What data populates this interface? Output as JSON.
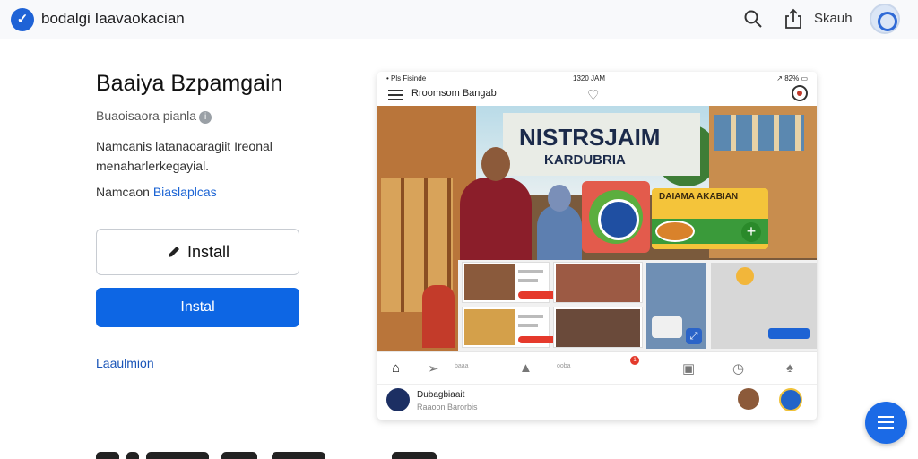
{
  "topbar": {
    "brand_icon": "checkmark-logo",
    "title": "bodalgi Iaavaokacian",
    "search_icon": "search-icon",
    "share_icon": "share-icon",
    "action_label": "Skauh",
    "avatar_icon": "profile-avatar"
  },
  "app": {
    "title": "Baaiya Bzpamgain",
    "subtitle": "Buaoisaora pianla",
    "info_icon": "info-icon",
    "description": "Namcanis latanaoaragiit Ireonal menaharlerkegayial.",
    "link_prefix": "Namcaon",
    "link_text": "Biaslaplcas",
    "install_outline_label": "Install",
    "install_outline_icon": "pencil-icon",
    "install_primary_label": "Instal",
    "bottom_link": "Laaulmion"
  },
  "preview": {
    "status_left": "• Pls Fisinde",
    "status_mid": "1320 JAM",
    "status_right": "↗ 82% ▭",
    "header_title": "Rroomsom Bangab",
    "sign_title": "NISTRSJAIM",
    "sign_subtitle": "KARDUBRIA",
    "promo_title": "DAIAMA AKABIAN",
    "nav": [
      {
        "icon": "home-icon",
        "glyph": "⌂",
        "label": ""
      },
      {
        "icon": "forward-icon",
        "glyph": "➢",
        "label": "baaa"
      },
      {
        "icon": "up-arrow-icon",
        "glyph": "▲",
        "label": "ooba"
      },
      {
        "icon": "card-icon",
        "glyph": "▣",
        "label": ""
      },
      {
        "icon": "clock-icon",
        "glyph": "◷",
        "label": ""
      },
      {
        "icon": "bell-icon",
        "glyph": "♠",
        "label": ""
      }
    ],
    "nav_badge": "1",
    "footer_name": "Dubagbiaait",
    "footer_sub": "Raaoon Barorbis"
  },
  "fab": {
    "icon": "menu-lines-icon"
  }
}
